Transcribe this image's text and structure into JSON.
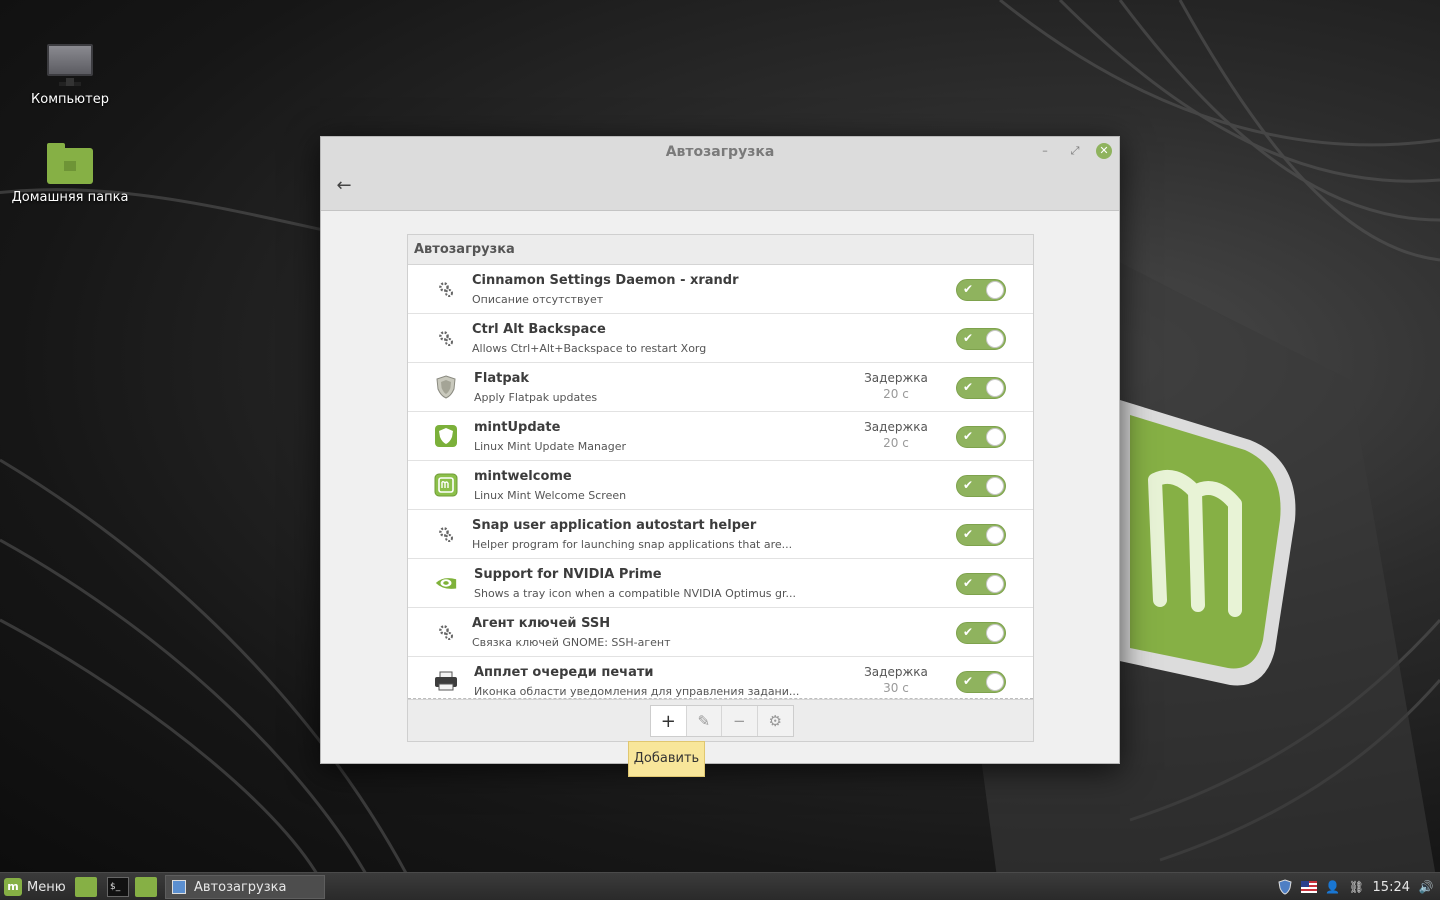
{
  "desktop": {
    "icons": [
      {
        "label": "Компьютер"
      },
      {
        "label": "Домашняя папка"
      }
    ]
  },
  "window": {
    "title": "Автозагрузка",
    "panel_header": "Автозагрузка",
    "accent": "#8fb35e",
    "items": [
      {
        "title": "Cinnamon Settings Daemon - xrandr",
        "desc": "Описание отсутствует",
        "icon": "gear-icon",
        "enabled": true
      },
      {
        "title": "Ctrl Alt Backspace",
        "desc": "Allows Ctrl+Alt+Backspace to restart Xorg",
        "icon": "gear-icon",
        "enabled": true
      },
      {
        "title": "Flatpak",
        "desc": "Apply Flatpak updates",
        "icon": "shield-icon",
        "delay_label": "Задержка",
        "delay_value": "20 с",
        "enabled": true
      },
      {
        "title": "mintUpdate",
        "desc": "Linux Mint Update Manager",
        "icon": "mint-shield-icon",
        "delay_label": "Задержка",
        "delay_value": "20 с",
        "enabled": true
      },
      {
        "title": "mintwelcome",
        "desc": "Linux Mint Welcome Screen",
        "icon": "mint-logo-icon",
        "enabled": true
      },
      {
        "title": "Snap user application autostart helper",
        "desc": "Helper program for launching snap applications that are...",
        "icon": "gear-icon",
        "enabled": true
      },
      {
        "title": "Support for NVIDIA Prime",
        "desc": "Shows a tray icon when a compatible NVIDIA Optimus gr...",
        "icon": "nvidia-icon",
        "enabled": true
      },
      {
        "title": "Агент ключей SSH",
        "desc": "Связка ключей GNOME: SSH-агент",
        "icon": "gear-icon",
        "enabled": true
      },
      {
        "title": "Апплет очереди печати",
        "desc": "Иконка области уведомления для управления задани...",
        "icon": "printer-icon",
        "delay_label": "Задержка",
        "delay_value": "30 с",
        "enabled": true
      }
    ],
    "toolbar": {
      "add": "+",
      "tooltip": "Добавить"
    }
  },
  "taskbar": {
    "menu_label": "Меню",
    "task_label": "Автозагрузка",
    "clock": "15:24"
  }
}
